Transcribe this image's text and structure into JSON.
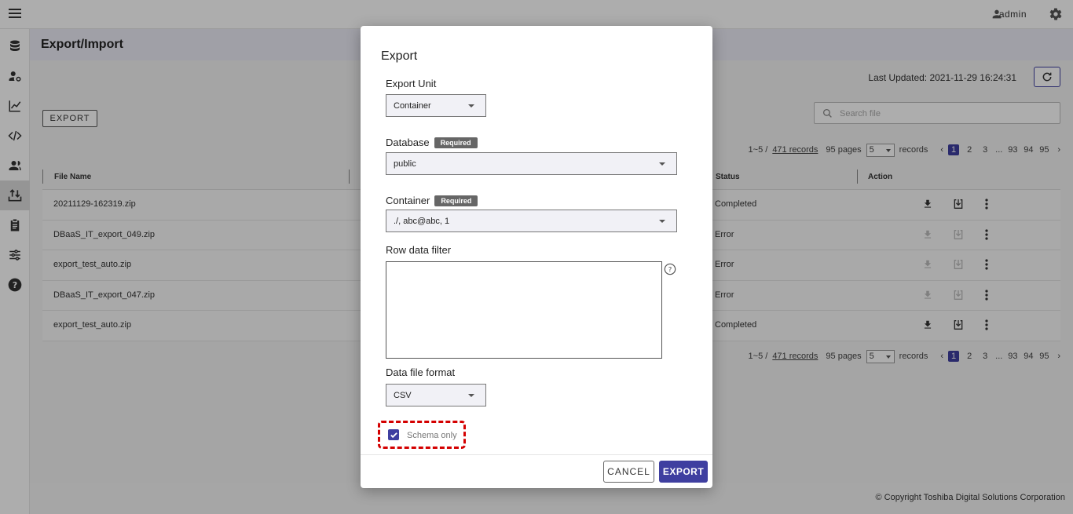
{
  "topbar": {
    "user": "admin"
  },
  "sidebar": {
    "items": [
      {
        "icon": "database-icon"
      },
      {
        "icon": "user-settings-icon"
      },
      {
        "icon": "chart-line-icon"
      },
      {
        "icon": "code-icon"
      },
      {
        "icon": "users-icon"
      },
      {
        "icon": "export-import-icon",
        "active": true
      },
      {
        "icon": "clipboard-icon"
      },
      {
        "icon": "settings-sliders-icon"
      },
      {
        "icon": "help-icon"
      }
    ]
  },
  "page": {
    "title": "Export/Import",
    "last_updated": "Last Updated: 2021-11-29 16:24:31",
    "export_button": "EXPORT",
    "search_placeholder": "Search file"
  },
  "pager": {
    "range": "1~5 /",
    "records_link": "471 records",
    "pages": "95 pages",
    "per_page": "5",
    "records_label": "records",
    "pages_list": [
      "1",
      "2",
      "3",
      "...",
      "93",
      "94",
      "95"
    ],
    "current": "1"
  },
  "table": {
    "columns": {
      "file_name": "File Name",
      "status": "Status",
      "action": "Action"
    },
    "rows": [
      {
        "file": "20211129-162319.zip",
        "status": "Completed",
        "enabled": true
      },
      {
        "file": "DBaaS_IT_export_049.zip",
        "status": "Error",
        "enabled": false
      },
      {
        "file": "export_test_auto.zip",
        "status": "Error",
        "enabled": false
      },
      {
        "file": "DBaaS_IT_export_047.zip",
        "status": "Error",
        "enabled": false
      },
      {
        "file": "export_test_auto.zip",
        "status": "Completed",
        "enabled": true
      }
    ]
  },
  "footer": {
    "copyright": "© Copyright Toshiba Digital Solutions Corporation"
  },
  "dialog": {
    "title": "Export",
    "export_unit_label": "Export Unit",
    "export_unit_value": "Container",
    "database_label": "Database",
    "required": "Required",
    "database_value": "public",
    "container_label": "Container",
    "container_value": "./, abc@abc, 1",
    "row_filter_label": "Row data filter",
    "row_filter_value": "",
    "format_label": "Data file format",
    "format_value": "CSV",
    "schema_only_label": "Schema only",
    "schema_only_checked": true,
    "cancel": "CANCEL",
    "export": "EXPORT"
  },
  "colors": {
    "accent": "#3f3fa0",
    "highlight": "#d40000"
  }
}
